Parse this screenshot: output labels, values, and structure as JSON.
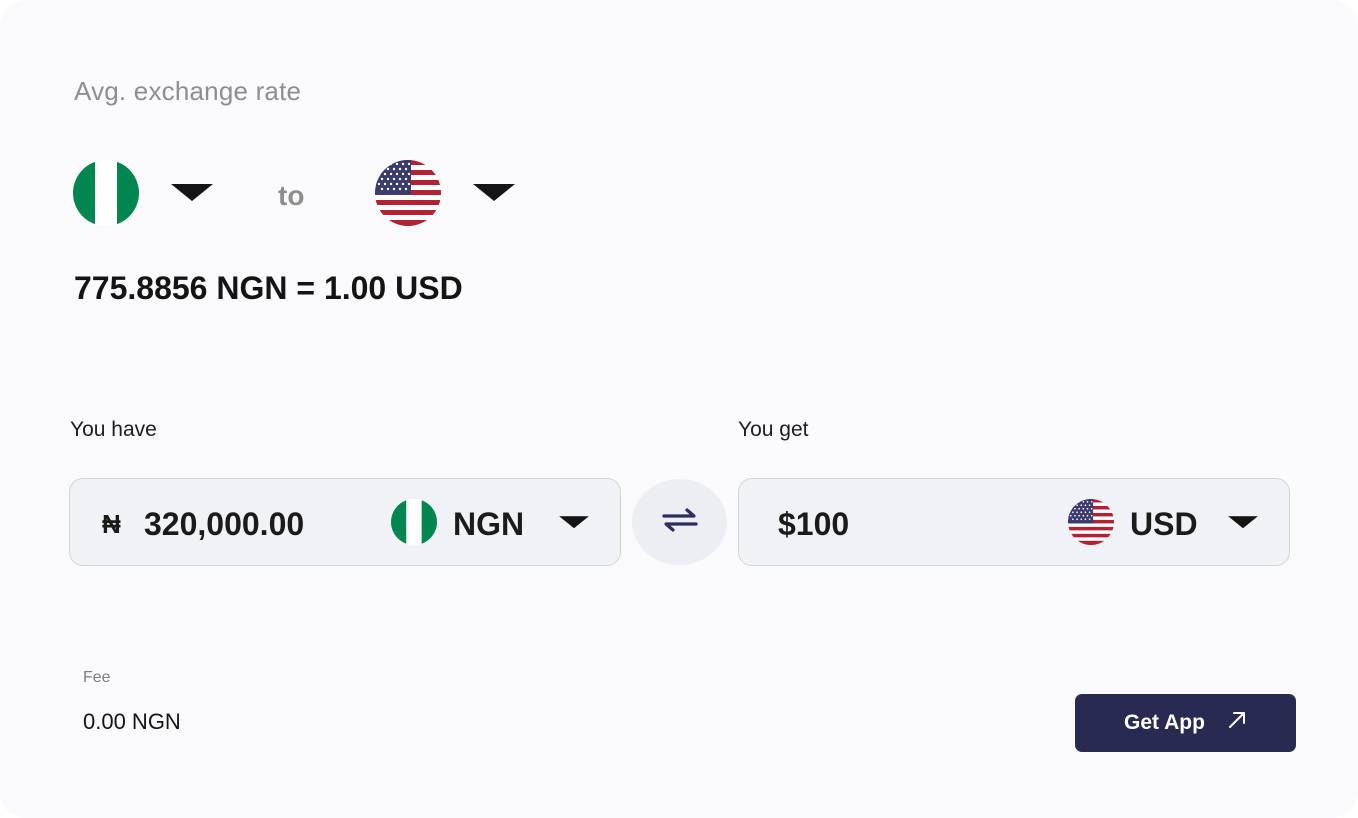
{
  "rate_section": {
    "heading": "Avg. exchange rate",
    "from_flag": "nigeria-flag",
    "to_label": "to",
    "to_flag": "usa-flag",
    "rate_text": "775.8856 NGN = 1.00 USD"
  },
  "converter": {
    "have": {
      "label": "You have",
      "currency_symbol": "₦",
      "amount": "320,000.00",
      "currency_code": "NGN",
      "flag": "nigeria-flag"
    },
    "swap_icon": "swap-arrows-icon",
    "get": {
      "label": "You get",
      "amount": "$100",
      "currency_code": "USD",
      "flag": "usa-flag"
    }
  },
  "fee": {
    "label": "Fee",
    "value": "0.00 NGN"
  },
  "cta": {
    "label": "Get App",
    "icon": "arrow-up-right-icon"
  },
  "colors": {
    "background": "#fafafc",
    "button": "#282a52",
    "field": "#f1f2f6",
    "nigeria_green": "#008751",
    "usa_red": "#b22234",
    "usa_blue": "#3c3b6e"
  }
}
